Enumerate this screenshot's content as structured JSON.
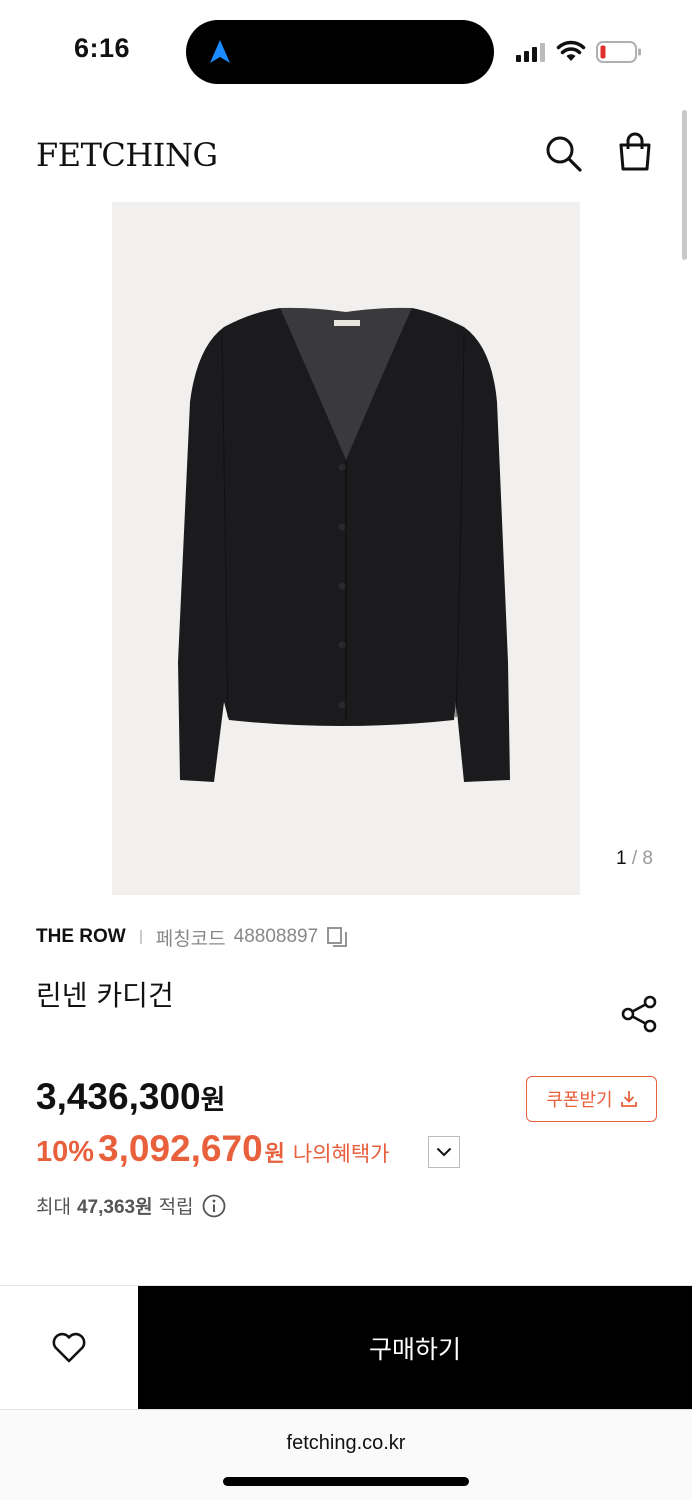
{
  "status_bar": {
    "time": "6:16",
    "icons": [
      "navigation-arrow-icon",
      "cellular-signal-icon",
      "wifi-icon",
      "battery-low-icon"
    ],
    "colors": {
      "nav_arrow": "#1a8cff",
      "battery_low": "#e0302e"
    }
  },
  "header": {
    "logo": "FETCHING",
    "icons": [
      "search-icon",
      "shopping-bag-icon"
    ]
  },
  "gallery": {
    "current": "1",
    "separator": " / ",
    "total": "8"
  },
  "product": {
    "brand": "THE ROW",
    "code_label": "페칭코드",
    "code_value": "48808897",
    "name": "린넨 카디건"
  },
  "pricing": {
    "original_price": "3,436,300",
    "currency": "원",
    "discount": "10%",
    "sale_price": "3,092,670",
    "my_benefit_label": "나의혜택가",
    "coupon_button": "쿠폰받기",
    "points_prefix": "최대",
    "points_value": "47,363원",
    "points_suffix": "적립"
  },
  "actions": {
    "buy_button": "구매하기"
  },
  "browser": {
    "url": "fetching.co.kr"
  },
  "colors": {
    "accent": "#e8603c",
    "buy_bg": "#000000",
    "image_bg": "#f1f0ee"
  }
}
